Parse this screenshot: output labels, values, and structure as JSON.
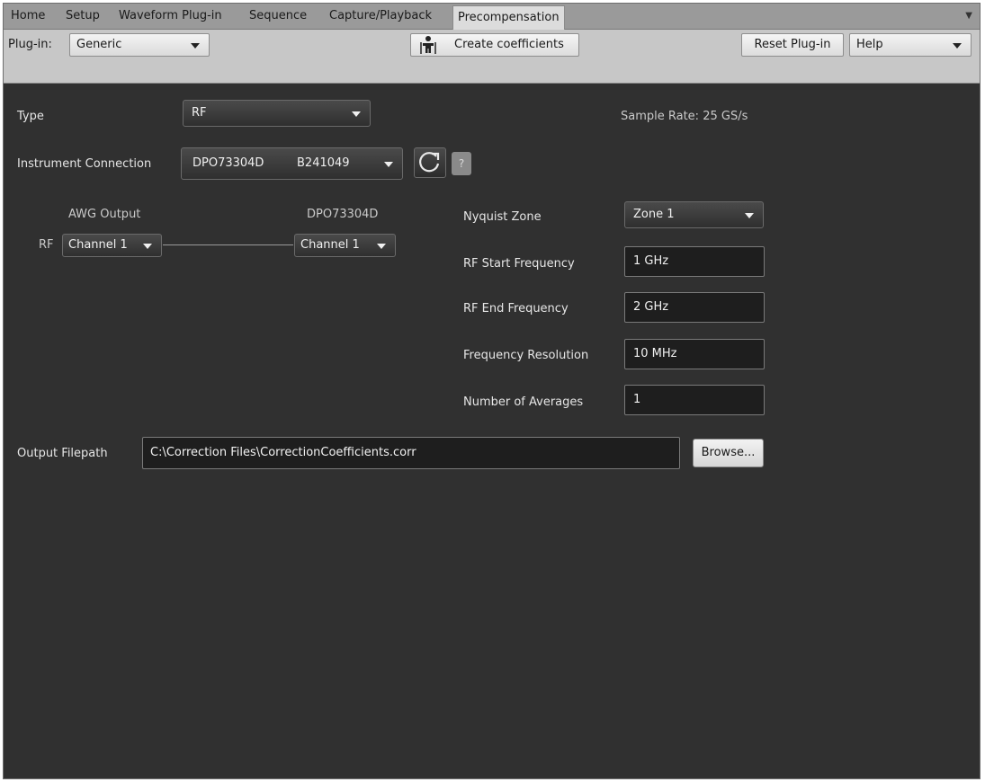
{
  "tabs": [
    {
      "label": "Home",
      "active": false
    },
    {
      "label": "Setup",
      "active": false
    },
    {
      "label": "Waveform Plug-in",
      "active": false
    },
    {
      "label": "Sequence",
      "active": false
    },
    {
      "label": "Capture/Playback",
      "active": false
    },
    {
      "label": "Precompensation",
      "active": true
    }
  ],
  "toolbar": {
    "plugin_label": "Plug-in:",
    "plugin_value": "Generic",
    "create_label": "Create coefficients",
    "reset_label": "Reset Plug-in",
    "help_value": "Help"
  },
  "form": {
    "type_label": "Type",
    "type_value": "RF",
    "sample_rate_label": "Sample Rate:",
    "sample_rate_value": "25 GS/s",
    "instrument_label": "Instrument Connection",
    "instrument_model": "DPO73304D",
    "instrument_serial": "B241049",
    "help_mini": "?",
    "awg_output_label": "AWG Output",
    "scope_label": "DPO73304D",
    "rf_label": "RF",
    "awg_channel": "Channel 1",
    "scope_channel": "Channel 1",
    "nyquist_label": "Nyquist Zone",
    "nyquist_value": "Zone 1",
    "rf_start_label": "RF Start Frequency",
    "rf_start_value": "1 GHz",
    "rf_end_label": "RF End Frequency",
    "rf_end_value": "2 GHz",
    "freq_res_label": "Frequency Resolution",
    "freq_res_value": "10 MHz",
    "averages_label": "Number of Averages",
    "averages_value": "1",
    "output_label": "Output Filepath",
    "output_value": "C:\\Correction Files\\CorrectionCoefficients.corr",
    "browse_label": "Browse..."
  },
  "icons": {
    "create": "wand-figure-icon",
    "refresh": "refresh-icon",
    "dropdown": "chevron-down-icon"
  }
}
